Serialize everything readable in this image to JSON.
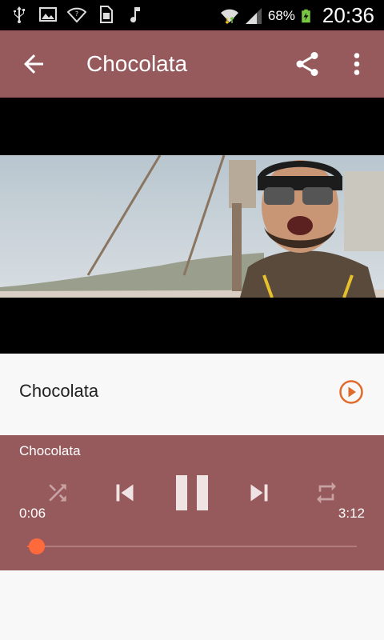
{
  "status_bar": {
    "battery": "68%",
    "time": "20:36",
    "icons": [
      "usb-icon",
      "image-icon",
      "wifi-icon",
      "sim-icon",
      "music-note-icon",
      "wifi-transfer-icon",
      "signal-icon",
      "battery-charging-icon"
    ]
  },
  "toolbar": {
    "title": "Chocolata",
    "back_icon": "arrow-back-icon",
    "share_icon": "share-icon",
    "more_icon": "more-vert-icon",
    "color": "#965a5d"
  },
  "song_list": {
    "item_title": "Chocolata",
    "play_icon": "play-circle-icon",
    "accent": "#e06a2a"
  },
  "player": {
    "title": "Chocolata",
    "current_time": "0:06",
    "total_time": "3:12",
    "progress": 0.03,
    "playing": true,
    "controls": [
      "shuffle-icon",
      "skip-previous-icon",
      "pause-icon",
      "skip-next-icon",
      "repeat-icon"
    ],
    "accent": "#ff6a3d"
  }
}
